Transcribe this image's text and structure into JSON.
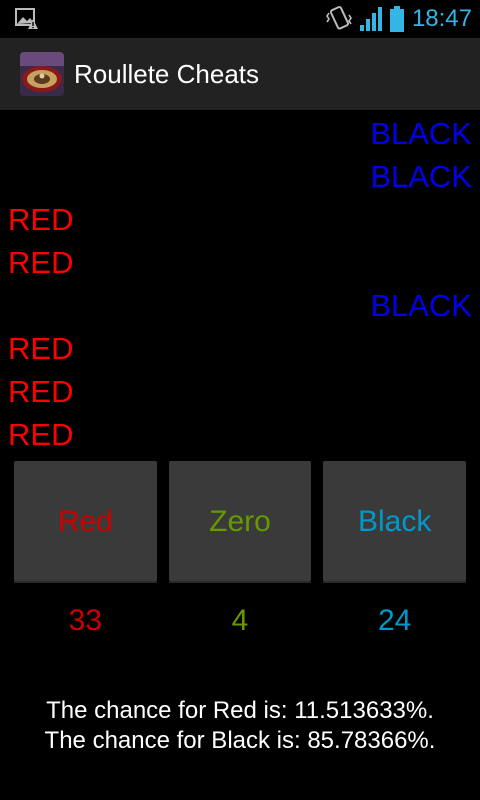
{
  "status_bar": {
    "time": "18:47",
    "colors": {
      "accent": "#33b5e5"
    }
  },
  "app": {
    "title": "Roullete Cheats"
  },
  "history": [
    {
      "label": "BLACK",
      "kind": "black"
    },
    {
      "label": "BLACK",
      "kind": "black"
    },
    {
      "label": "RED",
      "kind": "red"
    },
    {
      "label": "RED",
      "kind": "red"
    },
    {
      "label": "BLACK",
      "kind": "black"
    },
    {
      "label": "RED",
      "kind": "red"
    },
    {
      "label": "RED",
      "kind": "red"
    },
    {
      "label": "RED",
      "kind": "red"
    }
  ],
  "buttons": {
    "red": {
      "label": "Red",
      "color": "#cc0000"
    },
    "zero": {
      "label": "Zero",
      "color": "#669900"
    },
    "black": {
      "label": "Black",
      "color": "#0099cc"
    }
  },
  "counts": {
    "red": "33",
    "zero": "4",
    "black": "24"
  },
  "chances": {
    "red": "The chance for Red is: 11.513633%.",
    "black": "The chance for Black is: 85.78366%."
  }
}
